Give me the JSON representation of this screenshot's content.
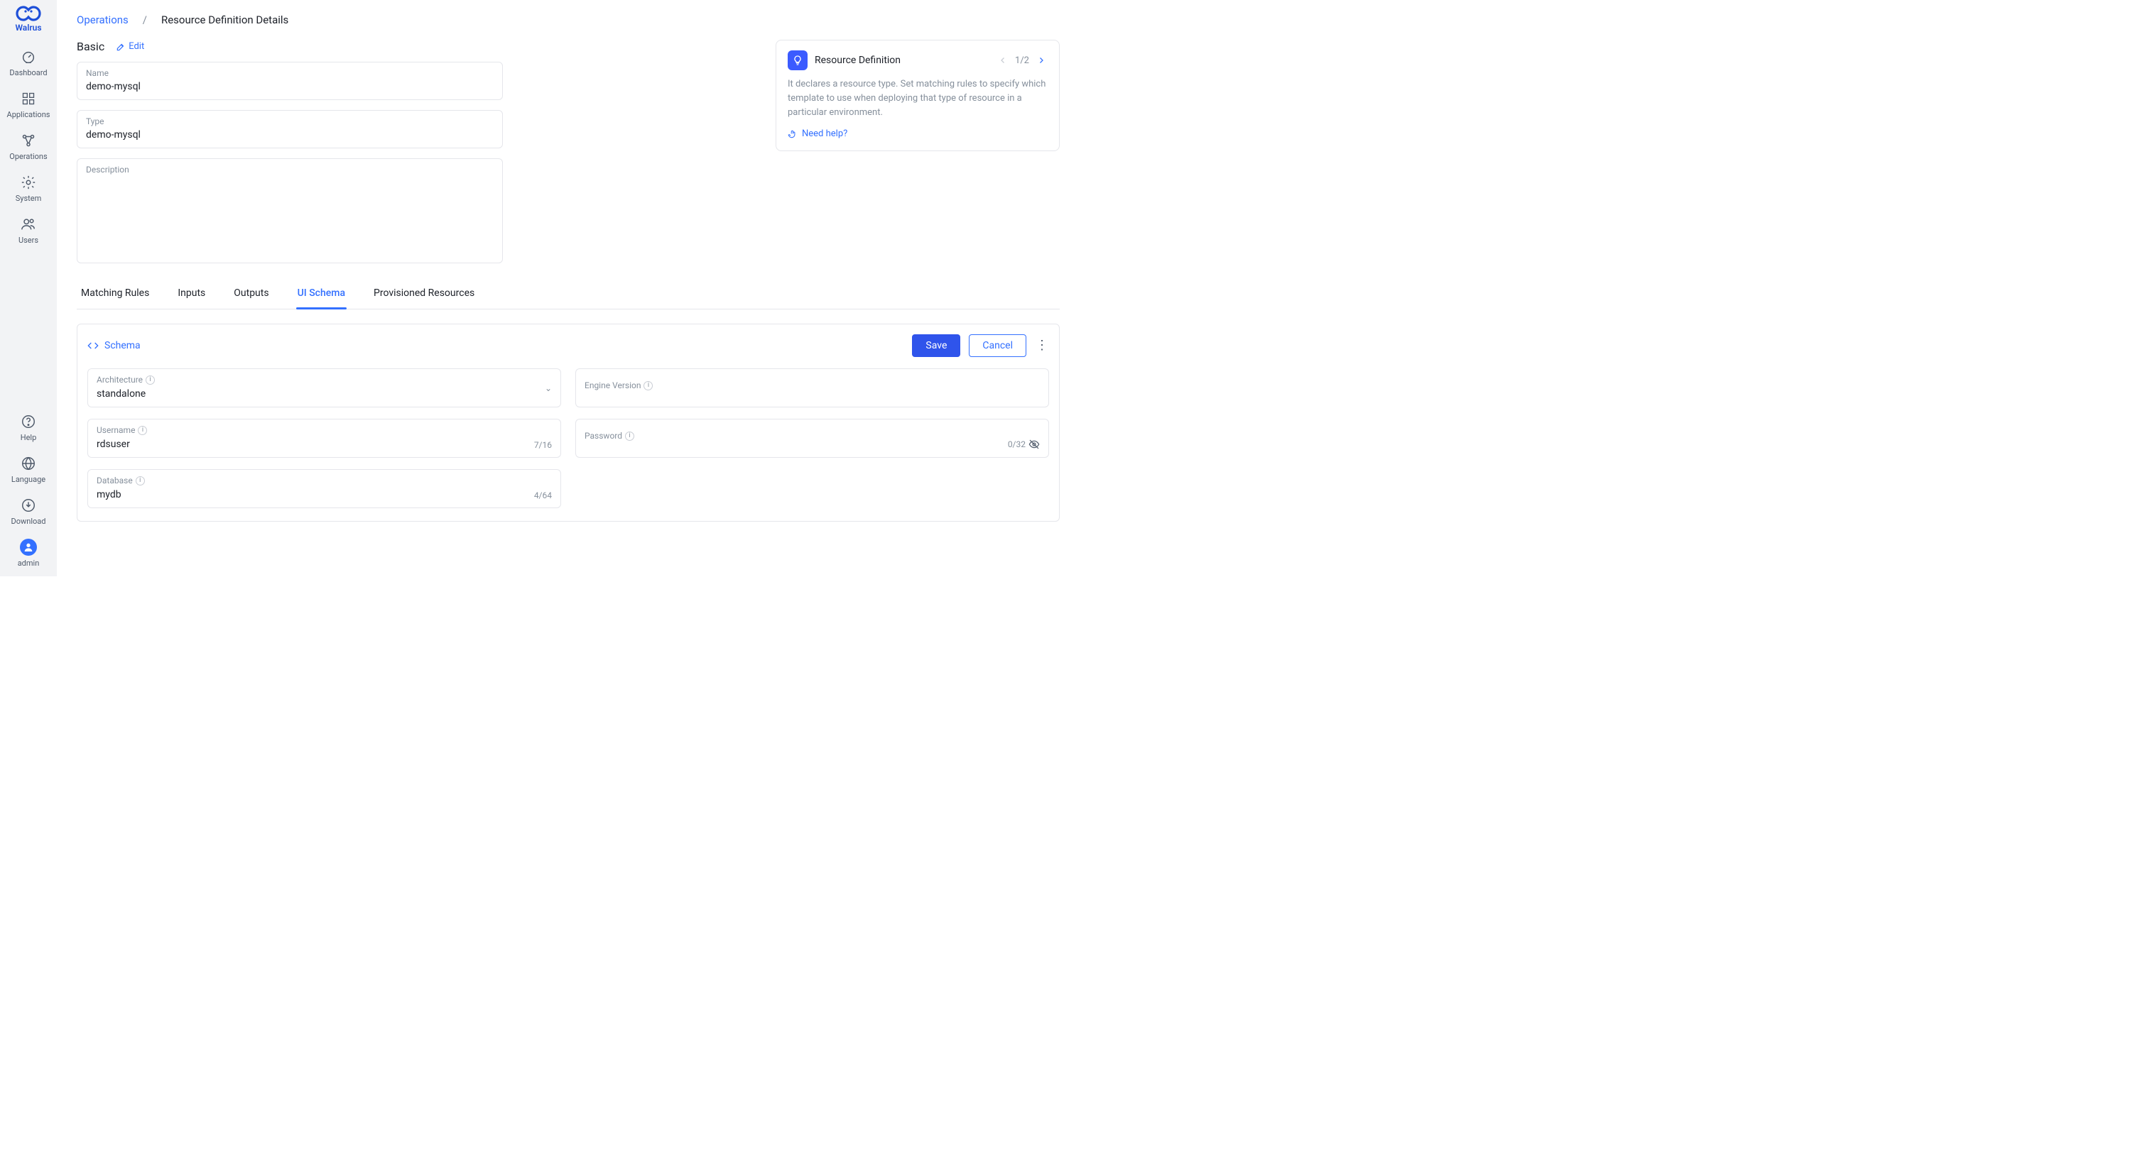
{
  "brand": {
    "name": "Walrus"
  },
  "sidebar": {
    "top": [
      {
        "label": "Dashboard",
        "icon": "gauge"
      },
      {
        "label": "Applications",
        "icon": "grid"
      },
      {
        "label": "Operations",
        "icon": "nodes"
      },
      {
        "label": "System",
        "icon": "gear"
      },
      {
        "label": "Users",
        "icon": "users"
      }
    ],
    "bottom": [
      {
        "label": "Help",
        "icon": "help"
      },
      {
        "label": "Language",
        "icon": "globe"
      },
      {
        "label": "Download",
        "icon": "download"
      },
      {
        "label": "admin",
        "icon": "avatar"
      }
    ]
  },
  "breadcrumb": {
    "link": "Operations",
    "sep": "/",
    "current": "Resource Definition Details"
  },
  "basic": {
    "title": "Basic",
    "edit": "Edit",
    "name_label": "Name",
    "name_value": "demo-mysql",
    "type_label": "Type",
    "type_value": "demo-mysql",
    "desc_label": "Description",
    "desc_value": ""
  },
  "help": {
    "title": "Resource Definition",
    "page": "1/2",
    "body": "It declares a resource type. Set matching rules to specify which template to use when deploying that type of resource in a particular environment.",
    "link": "Need help?"
  },
  "tabs": [
    "Matching Rules",
    "Inputs",
    "Outputs",
    "UI Schema",
    "Provisioned Resources"
  ],
  "activeTab": 3,
  "schema": {
    "title": "Schema",
    "save": "Save",
    "cancel": "Cancel",
    "fields": {
      "architecture_label": "Architecture",
      "architecture_value": "standalone",
      "engine_label": "Engine Version",
      "engine_value": "",
      "username_label": "Username",
      "username_value": "rdsuser",
      "username_counter": "7/16",
      "password_label": "Password",
      "password_value": "",
      "password_counter": "0/32",
      "database_label": "Database",
      "database_value": "mydb",
      "database_counter": "4/64"
    }
  }
}
